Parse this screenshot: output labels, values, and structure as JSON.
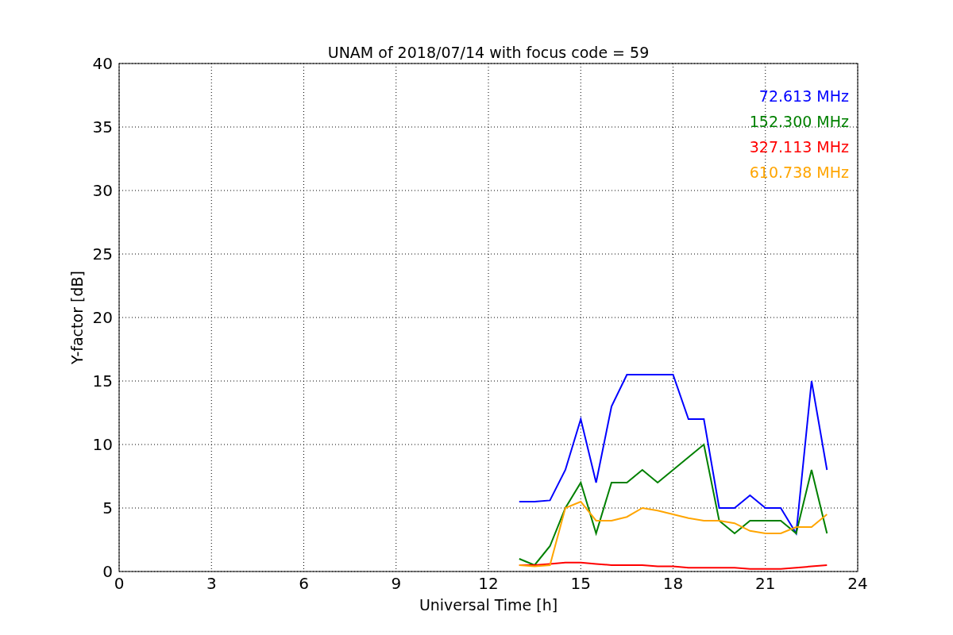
{
  "chart_data": {
    "type": "line",
    "title": "UNAM of 2018/07/14 with focus code = 59",
    "xlabel": "Universal Time [h]",
    "ylabel": "Y-factor [dB]",
    "x": [
      13,
      13.5,
      14,
      14.5,
      15,
      15.5,
      16,
      16.5,
      17,
      17.5,
      18,
      18.5,
      19,
      19.5,
      20,
      20.5,
      21,
      21.5,
      22,
      22.5,
      23
    ],
    "series": [
      {
        "name": "72.613 MHz",
        "color": "#0000ff",
        "values": [
          5.5,
          5.5,
          5.6,
          8,
          12,
          7,
          13,
          15.5,
          15.5,
          15.5,
          15.5,
          12,
          12,
          5,
          5,
          6,
          5,
          5,
          3,
          15,
          8
        ]
      },
      {
        "name": "152.300 MHz",
        "color": "#008000",
        "values": [
          1,
          0.5,
          2,
          5,
          7,
          3,
          7,
          7,
          8,
          7,
          8,
          9,
          10,
          4,
          3,
          4,
          4,
          4,
          3,
          8,
          3
        ]
      },
      {
        "name": "327.113 MHz",
        "color": "#ff0000",
        "values": [
          0.5,
          0.5,
          0.6,
          0.7,
          0.7,
          0.6,
          0.5,
          0.5,
          0.5,
          0.4,
          0.4,
          0.3,
          0.3,
          0.3,
          0.3,
          0.2,
          0.2,
          0.2,
          0.3,
          0.4,
          0.5
        ]
      },
      {
        "name": "610.738 MHz",
        "color": "#ffa500",
        "values": [
          0.5,
          0.4,
          0.5,
          5,
          5.5,
          4,
          4,
          4.3,
          5,
          4.8,
          4.5,
          4.2,
          4,
          4,
          3.8,
          3.2,
          3,
          3,
          3.5,
          3.5,
          4.5
        ]
      }
    ],
    "xlim": [
      0,
      24
    ],
    "ylim": [
      0,
      40
    ],
    "xticks": [
      0,
      3,
      6,
      9,
      12,
      15,
      18,
      21,
      24
    ],
    "yticks": [
      0,
      5,
      10,
      15,
      20,
      25,
      30,
      35,
      40
    ],
    "grid": true
  }
}
